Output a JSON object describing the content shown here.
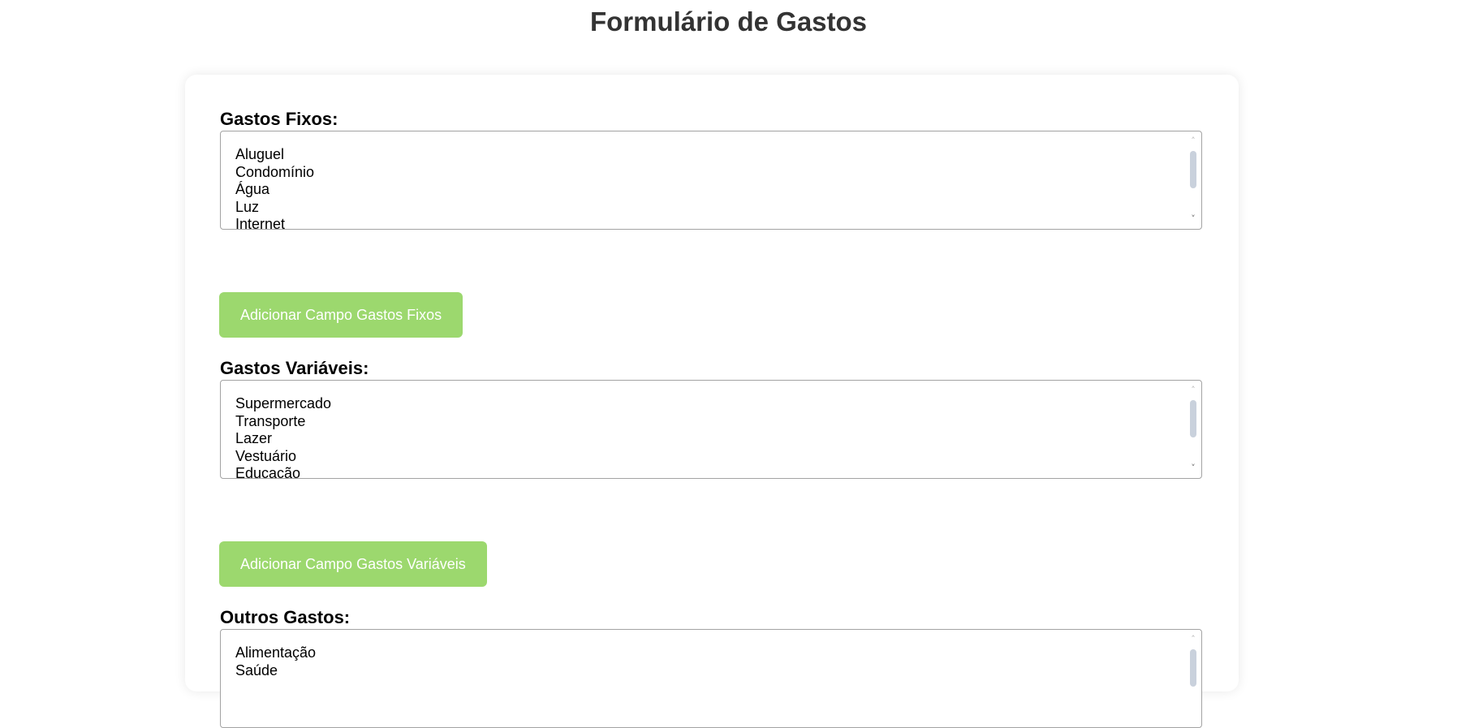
{
  "page": {
    "title": "Formulário de Gastos"
  },
  "sections": [
    {
      "label": "Gastos Fixos:",
      "options": [
        "Aluguel",
        "Condomínio",
        "Água",
        "Luz",
        "Internet"
      ],
      "button_label": "Adicionar Campo Gastos Fixos"
    },
    {
      "label": "Gastos Variáveis:",
      "options": [
        "Supermercado",
        "Transporte",
        "Lazer",
        "Vestuário",
        "Educação"
      ],
      "button_label": "Adicionar Campo Gastos Variáveis"
    },
    {
      "label": "Outros Gastos:",
      "options": [
        "Alimentação",
        "Saúde"
      ]
    }
  ],
  "icons": {
    "scroll_up": "chevron-up-icon",
    "scroll_down": "chevron-down-icon"
  },
  "colors": {
    "button_background": "#9cd86e",
    "button_text": "#ffffff",
    "title_text": "#333333"
  }
}
